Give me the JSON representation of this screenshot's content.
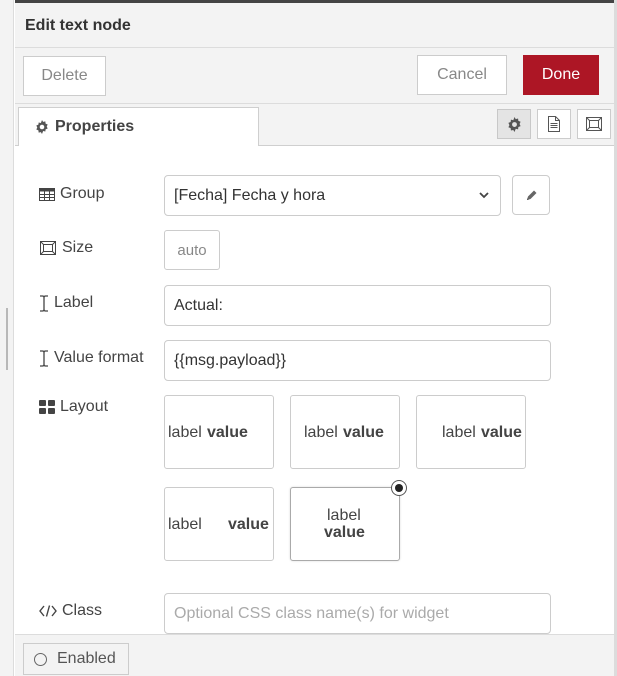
{
  "dialog": {
    "title": "Edit text node"
  },
  "toolbar": {
    "delete_label": "Delete",
    "cancel_label": "Cancel",
    "done_label": "Done"
  },
  "tabs": {
    "properties_label": "Properties",
    "icons": [
      "gear-icon",
      "description-icon",
      "appearance-icon"
    ]
  },
  "form": {
    "group": {
      "label": "Group",
      "value": "[Fecha] Fecha y hora",
      "icon": "table-icon"
    },
    "size": {
      "label": "Size",
      "value": "auto",
      "icon": "size-icon"
    },
    "label": {
      "label": "Label",
      "value": "Actual:",
      "icon": "text-cursor-icon"
    },
    "value_format": {
      "label": "Value format",
      "value": "{{msg.payload}}",
      "icon": "text-cursor-icon"
    },
    "layout": {
      "label": "Layout",
      "icon": "grid-icon",
      "options": [
        {
          "label": "label",
          "value": "value",
          "arrangement": "row-left"
        },
        {
          "label": "label",
          "value": "value",
          "arrangement": "row-center"
        },
        {
          "label": "label",
          "value": "value",
          "arrangement": "row-right"
        },
        {
          "label": "label",
          "value": "value",
          "arrangement": "row-spread"
        },
        {
          "label": "label",
          "value": "value",
          "arrangement": "column-center"
        }
      ],
      "selected_index": 4
    },
    "class": {
      "label": "Class",
      "value": "",
      "placeholder": "Optional CSS class name(s) for widget",
      "icon": "code-icon"
    }
  },
  "footer": {
    "enabled_label": "Enabled"
  },
  "colors": {
    "done_button": "#ad1625",
    "panel_bg": "#f3f3f3",
    "border": "#cccccc"
  }
}
